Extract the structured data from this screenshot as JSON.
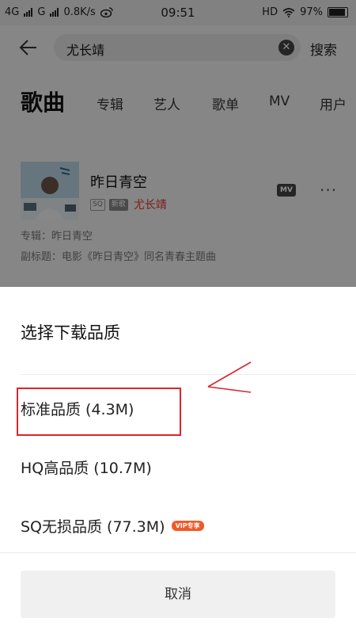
{
  "status_bar": {
    "network_left": "4G",
    "network_right": "G",
    "speed": "0.8K/s",
    "time": "09:51",
    "hd": "HD",
    "battery": "97%"
  },
  "search": {
    "query": "尤长靖",
    "search_label": "搜索"
  },
  "tabs": [
    {
      "label": "歌曲",
      "active": true
    },
    {
      "label": "专辑",
      "active": false
    },
    {
      "label": "艺人",
      "active": false
    },
    {
      "label": "歌单",
      "active": false
    },
    {
      "label": "MV",
      "active": false
    },
    {
      "label": "用户",
      "active": false
    }
  ],
  "song": {
    "title": "昨日青空",
    "tag_sq": "SQ",
    "tag_new": "新歌",
    "artist": "尤长靖",
    "mv_label": "MV",
    "more": "···",
    "album": "专辑：昨日青空",
    "subtitle": "副标题：电影《昨日青空》同名青春主题曲"
  },
  "sheet": {
    "title": "选择下载品质",
    "options": [
      {
        "label": "标准品质 (4.3M)",
        "badge": ""
      },
      {
        "label": "HQ高品质 (10.7M)",
        "badge": ""
      },
      {
        "label": "SQ无损品质 (77.3M)",
        "badge": "VIP专享"
      }
    ],
    "cancel": "取消"
  },
  "colors": {
    "accent": "#e03a2a",
    "annotation": "#d9262c",
    "vip_badge": "#f05a28"
  }
}
